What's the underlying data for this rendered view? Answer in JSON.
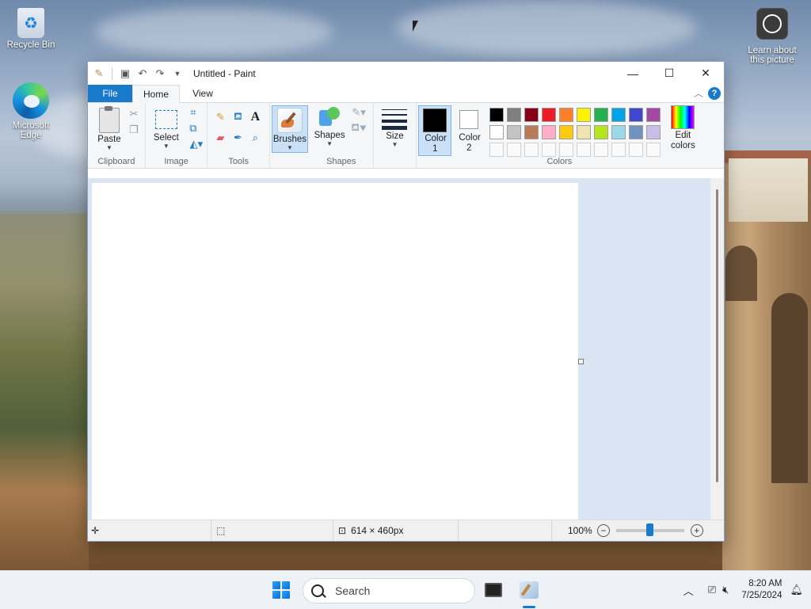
{
  "desktop": {
    "icons": [
      {
        "label": "Recycle Bin"
      },
      {
        "label": "Microsoft Edge"
      },
      {
        "label": "Learn about this picture"
      }
    ]
  },
  "window": {
    "title": "Untitled - Paint",
    "controls": {
      "minimize": "—",
      "maximize": "☐",
      "close": "✕"
    }
  },
  "ribbon": {
    "tabs": [
      {
        "label": "File"
      },
      {
        "label": "Home"
      },
      {
        "label": "View"
      }
    ],
    "groups": {
      "clipboard": {
        "label": "Clipboard",
        "paste": "Paste"
      },
      "image": {
        "label": "Image",
        "select": "Select"
      },
      "tools": {
        "label": "Tools"
      },
      "brushes": {
        "label": "Brushes"
      },
      "shapes": {
        "label": "Shapes",
        "button": "Shapes"
      },
      "size": {
        "label": "Size"
      },
      "colors": {
        "label": "Colors",
        "color1": "Color 1",
        "color2": "Color 2",
        "edit": "Edit colors",
        "color1_value": "#000000",
        "color2_value": "#ffffff",
        "palette_row1": [
          "#000000",
          "#7f7f7f",
          "#880015",
          "#ed1c24",
          "#ff7f27",
          "#fff200",
          "#22b14c",
          "#00a2e8",
          "#3f48cc",
          "#a349a4"
        ],
        "palette_row2": [
          "#ffffff",
          "#c3c3c3",
          "#b97a57",
          "#ffaec9",
          "#ffc90e",
          "#efe4b0",
          "#b5e61d",
          "#99d9ea",
          "#7092be",
          "#c8bfe7"
        ]
      }
    }
  },
  "canvas": {
    "size_text": "614 × 460px"
  },
  "status": {
    "zoom": "100%",
    "zoom_fraction": 0.5
  },
  "taskbar": {
    "search_placeholder": "Search",
    "time": "8:20 AM",
    "date": "7/25/2024"
  },
  "accent": "#1979ca"
}
